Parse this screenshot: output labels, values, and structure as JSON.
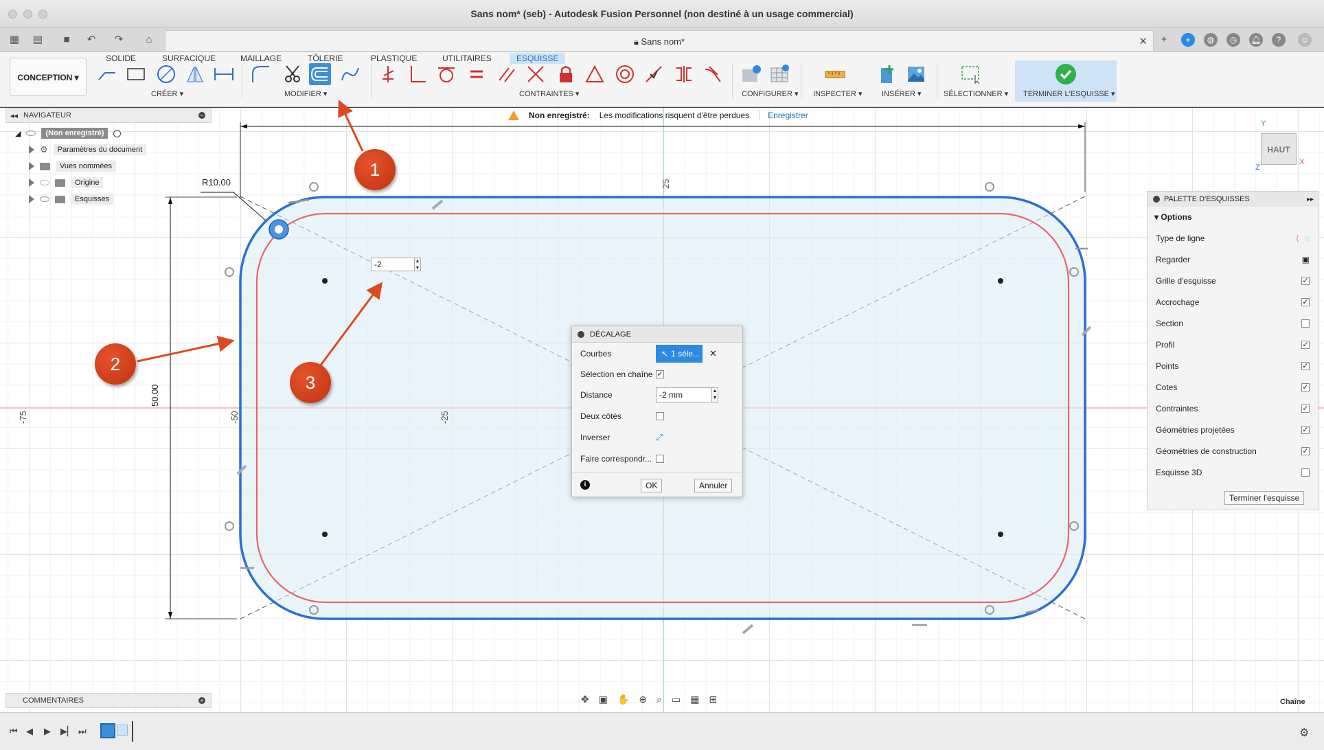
{
  "window": {
    "title": "Sans nom* (seb) - Autodesk Fusion Personnel (non destiné à un usage commercial)"
  },
  "document_tab": {
    "name": "Sans nom*"
  },
  "ribbon": {
    "workspace": "CONCEPTION",
    "tabs": [
      "SOLIDE",
      "SURFACIQUE",
      "MAILLAGE",
      "TÔLERIE",
      "PLASTIQUE",
      "UTILITAIRES",
      "ESQUISSE"
    ],
    "active_tab": "ESQUISSE",
    "groups": {
      "create": "CRÉER",
      "modify": "MODIFIER",
      "constraints": "CONTRAINTES",
      "configure": "CONFIGURER",
      "inspect": "INSPECTER",
      "insert": "INSÉRER",
      "select": "SÉLECTIONNER",
      "finish": "TERMINER L'ESQUISSE"
    }
  },
  "navigator": {
    "title": "NAVIGATEUR",
    "root": "(Non enregistré)",
    "items": [
      "Paramètres du document",
      "Vues nommées",
      "Origine",
      "Esquisses"
    ]
  },
  "warning": {
    "label": "Non enregistré:",
    "message": "Les modifications risquent d'être perdues",
    "action": "Enregistrer"
  },
  "viewcube": {
    "face": "HAUT",
    "axis_x": "X",
    "axis_y": "Y",
    "axis_z": "Z"
  },
  "sketch": {
    "radius_label": "R10.00",
    "height_label": "50.00",
    "inline_value": "-2",
    "axis_labels": {
      "top": "25",
      "left_far": "-75",
      "left": "-50",
      "center_left": "-25"
    }
  },
  "offset_dialog": {
    "title": "DÉCALAGE",
    "curves_label": "Courbes",
    "curves_value": "1 séle...",
    "chain_label": "Sélection en chaîne",
    "chain_checked": true,
    "distance_label": "Distance",
    "distance_value": "-2 mm",
    "two_sides_label": "Deux côtés",
    "two_sides_checked": false,
    "invert_label": "Inverser",
    "match_label": "Faire correspondr...",
    "match_checked": false,
    "ok": "OK",
    "cancel": "Annuler"
  },
  "palette": {
    "title": "PALETTE D'ESQUISSES",
    "section": "Options",
    "rows": [
      {
        "label": "Type de ligne",
        "kind": "icons"
      },
      {
        "label": "Regarder",
        "kind": "icon"
      },
      {
        "label": "Grille d'esquisse",
        "checked": true
      },
      {
        "label": "Accrochage",
        "checked": true
      },
      {
        "label": "Section",
        "checked": false
      },
      {
        "label": "Profil",
        "checked": true
      },
      {
        "label": "Points",
        "checked": true
      },
      {
        "label": "Cotes",
        "checked": true
      },
      {
        "label": "Contraintes",
        "checked": true
      },
      {
        "label": "Géométries projetées",
        "checked": true
      },
      {
        "label": "Géométries de construction",
        "checked": true
      },
      {
        "label": "Esquisse 3D",
        "checked": false
      }
    ],
    "finish_button": "Terminer l'esquisse"
  },
  "comments": {
    "title": "COMMENTAIRES"
  },
  "status": {
    "right": "Chaîne"
  },
  "callouts": [
    "1",
    "2",
    "3"
  ],
  "colors": {
    "accent": "#2d8ae0",
    "outer_profile": "#2a6fd6",
    "offset_profile": "#e8646a",
    "callout": "#d3421c"
  }
}
